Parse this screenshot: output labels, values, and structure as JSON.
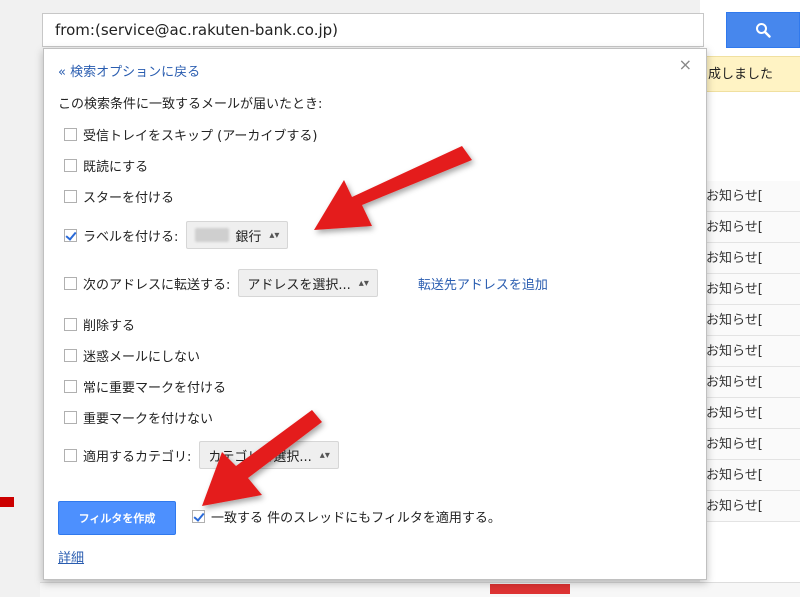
{
  "search": {
    "query": "from:(service@ac.rakuten-bank.co.jp)",
    "button_icon": "search-icon"
  },
  "background": {
    "notice": "成しました",
    "rows": [
      "お知らせ[",
      "お知らせ[",
      "お知らせ[",
      "お知らせ[",
      "お知らせ[",
      "お知らせ[",
      "お知らせ[",
      "お知らせ[",
      "お知らせ[",
      "お知らせ[",
      "お知らせ["
    ]
  },
  "dialog": {
    "back_link": "« 検索オプションに戻る",
    "close": "×",
    "intro": "この検索条件に一致するメールが届いたとき:",
    "options": {
      "skip_inbox": "受信トレイをスキップ (アーカイブする)",
      "mark_read": "既読にする",
      "star": "スターを付ける",
      "apply_label": "ラベルを付ける:",
      "label_value": "銀行",
      "forward": "次のアドレスに転送する:",
      "forward_value": "アドレスを選択...",
      "forward_add_link": "転送先アドレスを追加",
      "delete": "削除する",
      "never_spam": "迷惑メールにしない",
      "always_important": "常に重要マークを付ける",
      "never_important": "重要マークを付けない",
      "category": "適用するカテゴリ:",
      "category_value": "カテゴリを選択..."
    },
    "create_button": "フィルタを作成",
    "apply_to_existing": "一致する 件のスレッドにもフィルタを適用する。",
    "detail_link": "詳細"
  },
  "colors": {
    "accent": "#4d90fe",
    "link": "#2a5db0",
    "annotation_arrow": "#e41e1e"
  }
}
